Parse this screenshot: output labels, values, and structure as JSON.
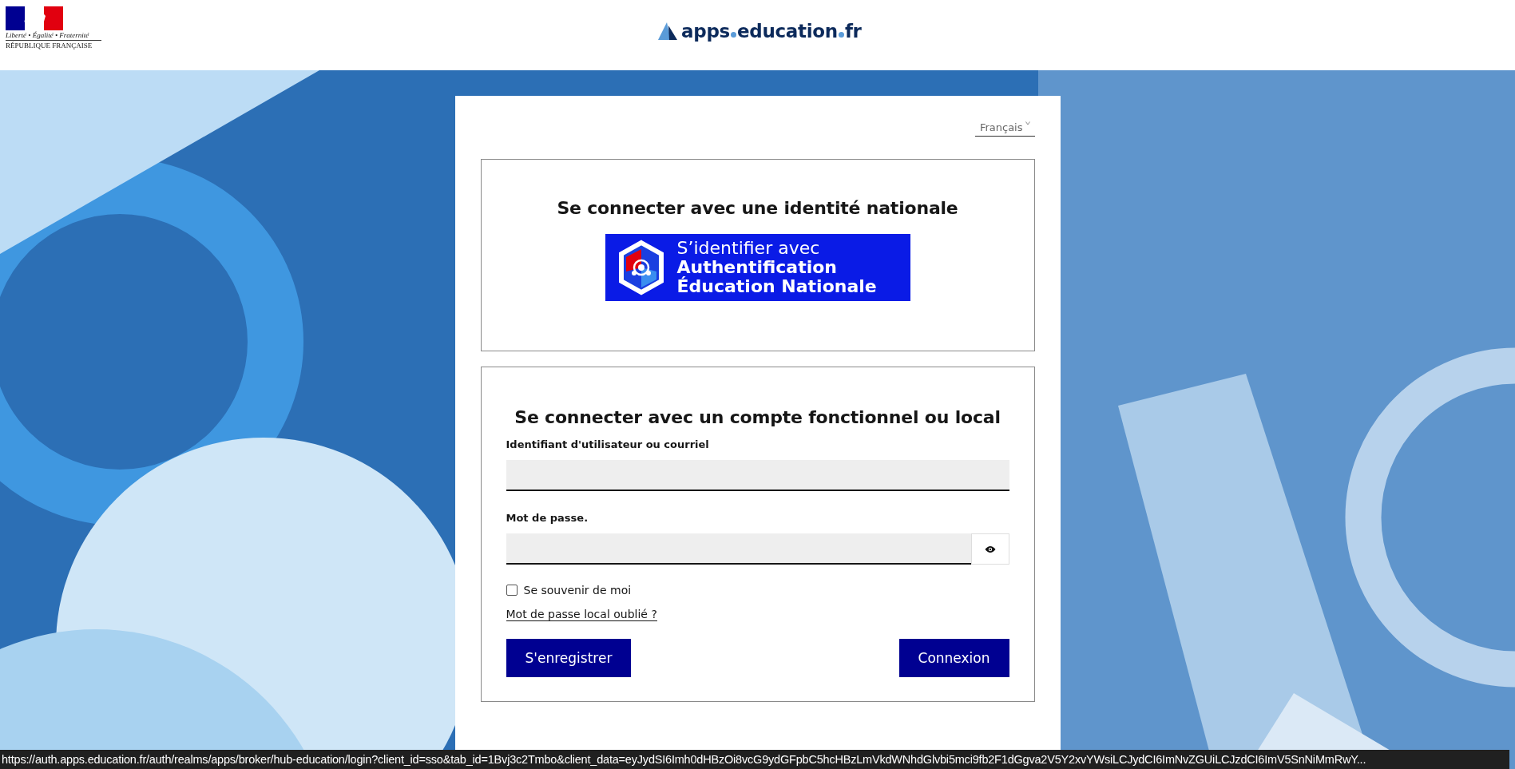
{
  "header": {
    "marianne": {
      "motto": "Liberté • Égalité • Fraternité",
      "name": "RÉPUBLIQUE FRANÇAISE"
    },
    "logo": {
      "parts": [
        "apps",
        "education",
        "fr"
      ]
    }
  },
  "card": {
    "language": {
      "value": "Français"
    },
    "national": {
      "title": "Se connecter avec une identité nationale",
      "button_lines": [
        "S’identifier avec",
        "Authentification",
        "Éducation Nationale"
      ]
    },
    "local": {
      "title": "Se connecter avec un compte fonctionnel ou local",
      "fields": [
        {
          "kind": "text",
          "label": "Identifiant d'utilisateur ou courriel"
        },
        {
          "kind": "password",
          "label": "Mot de passe."
        }
      ],
      "remember": {
        "label": "Se souvenir de moi",
        "checked": false
      },
      "forgot_link": "Mot de passe local oublié ?",
      "buttons": [
        "S'enregistrer",
        "Connexion"
      ]
    }
  },
  "status_bar": {
    "url": "https://auth.apps.education.fr/auth/realms/apps/broker/hub-education/login?client_id=sso&tab_id=1Bvj3c2Tmbo&client_data=eyJydSI6Imh0dHBzOi8vcG9ydGFpbC5hcHBzLmVkdWNhdGlvbi5mci9fb2F1dGgva2V5Y2xvYWsiLCJydCI6ImNvZGUiLCJzdCI6ImV5SnNiMmRwY..."
  }
}
